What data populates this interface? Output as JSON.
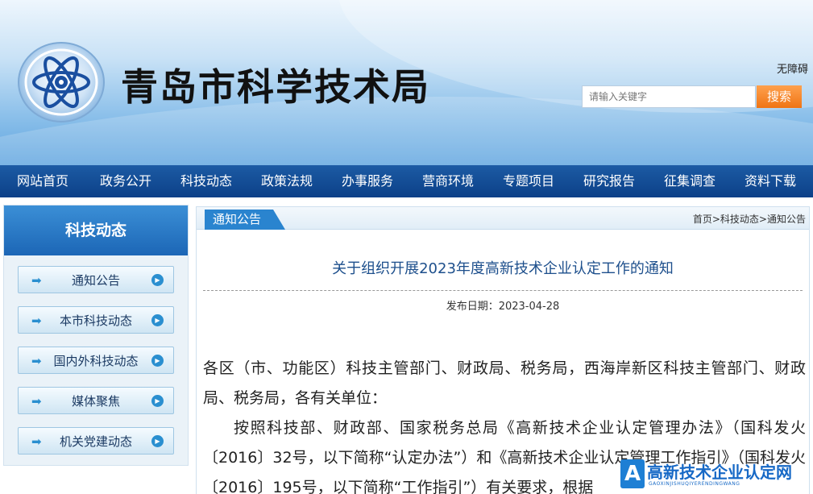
{
  "header": {
    "site_title": "青岛市科学技术局",
    "accessibility_label": "无障碍",
    "search_placeholder": "请输入关键字",
    "search_button": "搜索"
  },
  "nav": {
    "items": [
      "网站首页",
      "政务公开",
      "科技动态",
      "政策法规",
      "办事服务",
      "营商环境",
      "专题项目",
      "研究报告",
      "征集调查",
      "资料下载"
    ]
  },
  "sidebar": {
    "title": "科技动态",
    "items": [
      "通知公告",
      "本市科技动态",
      "国内外科技动态",
      "媒体聚焦",
      "机关党建动态"
    ]
  },
  "main": {
    "tab_label": "通知公告",
    "breadcrumb": [
      "首页",
      ">",
      "科技动态",
      ">",
      "通知公告"
    ],
    "article_title": "关于组织开展2023年度高新技术企业认定工作的通知",
    "publish_date": "发布日期：2023-04-28",
    "paragraphs": [
      "各区（市、功能区）科技主管部门、财政局、税务局，西海岸新区科技主管部门、财政局、税务局，各有关单位：",
      "按照科技部、财政部、国家税务总局《高新技术企业认定管理办法》（国科发火〔2016〕32号，以下简称“认定办法”）和《高新技术企业认定管理工作指引》（国科发火〔2016〕195号，以下简称“工作指引”）有关要求，根据"
    ]
  },
  "watermark": {
    "text": "高新技术企业认定网",
    "subtext": "GAOXINJISHUQIYERENDINGWANG"
  },
  "colors": {
    "nav_bg": "#0c4088",
    "accent": "#2a84cf",
    "search_button": "#ef7414",
    "title_blue": "#1d4f8c"
  }
}
